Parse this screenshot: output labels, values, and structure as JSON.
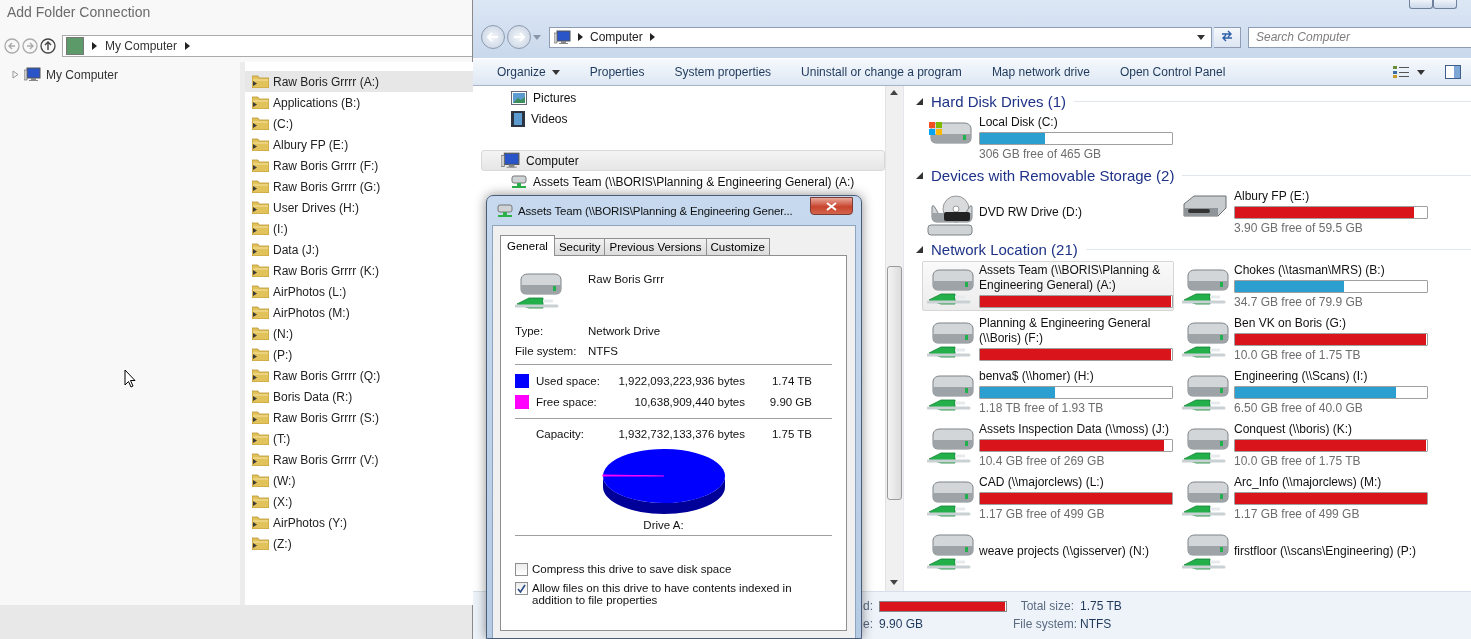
{
  "folder_dialog": {
    "title": "Add Folder Connection",
    "address": [
      "My Computer"
    ],
    "tree": [
      {
        "label": "My Computer",
        "expanded": false
      }
    ],
    "items": [
      {
        "label": "Raw Boris Grrrr (A:)",
        "selected": true
      },
      {
        "label": "Applications (B:)",
        "selected": false
      },
      {
        "label": "(C:)",
        "selected": false
      },
      {
        "label": "Albury FP (E:)",
        "selected": false
      },
      {
        "label": "Raw Boris Grrrr (F:)",
        "selected": false
      },
      {
        "label": "Raw Boris Grrrr (G:)",
        "selected": false
      },
      {
        "label": "User Drives (H:)",
        "selected": false
      },
      {
        "label": "(I:)",
        "selected": false
      },
      {
        "label": "Data (J:)",
        "selected": false
      },
      {
        "label": "Raw Boris Grrrr (K:)",
        "selected": false
      },
      {
        "label": "AirPhotos (L:)",
        "selected": false
      },
      {
        "label": "AirPhotos (M:)",
        "selected": false
      },
      {
        "label": "(N:)",
        "selected": false
      },
      {
        "label": "(P:)",
        "selected": false
      },
      {
        "label": "Raw Boris Grrrr (Q:)",
        "selected": false
      },
      {
        "label": "Boris Data (R:)",
        "selected": false
      },
      {
        "label": "Raw Boris Grrrr (S:)",
        "selected": false
      },
      {
        "label": "(T:)",
        "selected": false
      },
      {
        "label": "Raw Boris Grrrr (V:)",
        "selected": false
      },
      {
        "label": "(W:)",
        "selected": false
      },
      {
        "label": "(X:)",
        "selected": false
      },
      {
        "label": "AirPhotos (Y:)",
        "selected": false
      },
      {
        "label": "(Z:)",
        "selected": false
      }
    ]
  },
  "explorer": {
    "address": [
      "Computer"
    ],
    "search": {
      "placeholder": "Search Computer"
    },
    "toolbar": [
      {
        "label": "Organize",
        "kind": "menu"
      },
      {
        "label": "Properties",
        "kind": "button"
      },
      {
        "label": "System properties",
        "kind": "button"
      },
      {
        "label": "Uninstall or change a program",
        "kind": "button"
      },
      {
        "label": "Map network drive",
        "kind": "button"
      },
      {
        "label": "Open Control Panel",
        "kind": "button"
      }
    ],
    "nav": [
      {
        "label": "Pictures",
        "kind": "pictures",
        "selected": false
      },
      {
        "label": "Videos",
        "kind": "videos",
        "selected": false
      },
      {
        "label": "Computer",
        "kind": "computer",
        "selected": true,
        "children": [
          {
            "label": "Assets Team (\\\\BORIS\\Planning & Engineering General) (A:)",
            "kind": "network",
            "selected": false
          }
        ]
      }
    ],
    "groups": [
      {
        "title": "Hard Disk Drives (1)",
        "expanded": true,
        "drives": [
          {
            "name": "Local Disk (C:)",
            "kind": "windows",
            "level": 0.34,
            "color": "#2b9fd0",
            "free": "306 GB free of 465 GB",
            "selected": false
          }
        ]
      },
      {
        "title": "Devices with Removable Storage (2)",
        "expanded": true,
        "drives": [
          {
            "name": "DVD RW Drive (D:)",
            "kind": "dvd",
            "selected": false
          },
          {
            "name": "Albury FP (E:)",
            "kind": "removable",
            "level": 0.93,
            "color": "#d9141b",
            "free": "3.90 GB free of 59.5 GB",
            "selected": false
          }
        ]
      },
      {
        "title": "Network Location (21)",
        "expanded": true,
        "drives": [
          {
            "name": "Assets Team (\\\\BORIS\\Planning & Engineering General) (A:)",
            "kind": "network",
            "level": 0.995,
            "color": "#d9141b",
            "selected": true
          },
          {
            "name": "Chokes (\\\\tasman\\MRS) (B:)",
            "kind": "network",
            "level": 0.57,
            "color": "#2b9fd0",
            "free": "34.7 GB free of 79.9 GB",
            "selected": false
          },
          {
            "name": "Planning & Engineering General (\\\\Boris) (F:)",
            "kind": "network",
            "level": 0.995,
            "color": "#d9141b",
            "selected": false
          },
          {
            "name": "Ben VK on Boris (G:)",
            "kind": "network",
            "level": 0.995,
            "color": "#d9141b",
            "free": "10.0 GB free of 1.75 TB",
            "selected": false
          },
          {
            "name": "benva$ (\\\\homer) (H:)",
            "kind": "network",
            "level": 0.39,
            "color": "#2b9fd0",
            "free": "1.18 TB free of 1.93 TB",
            "selected": false
          },
          {
            "name": "Engineering (\\\\Scans) (I:)",
            "kind": "network",
            "level": 0.84,
            "color": "#2b9fd0",
            "free": "6.50 GB free of 40.0 GB",
            "selected": false
          },
          {
            "name": "Assets Inspection Data (\\\\moss) (J:)",
            "kind": "network",
            "level": 0.96,
            "color": "#d9141b",
            "free": "10.4 GB free of 269 GB",
            "selected": false
          },
          {
            "name": "Conquest (\\\\boris) (K:)",
            "kind": "network",
            "level": 0.995,
            "color": "#d9141b",
            "free": "10.0 GB free of 1.75 TB",
            "selected": false
          },
          {
            "name": "CAD (\\\\majorclews) (L:)",
            "kind": "network",
            "level": 0.998,
            "color": "#d9141b",
            "free": "1.17 GB free of 499 GB",
            "selected": false
          },
          {
            "name": "Arc_Info (\\\\majorclews) (M:)",
            "kind": "network",
            "level": 0.998,
            "color": "#d9141b",
            "free": "1.17 GB free of 499 GB",
            "selected": false
          },
          {
            "name": "weave projects (\\\\gisserver) (N:)",
            "kind": "network",
            "selected": false
          },
          {
            "name": "firstfloor (\\\\scans\\Engineering) (P:)",
            "kind": "network",
            "selected": false
          }
        ]
      }
    ],
    "details": [
      {
        "label": "d:",
        "kind": "bar",
        "level": 0.995,
        "color": "#d9141b"
      },
      {
        "label": "e:",
        "kind": "text",
        "value": "9.90 GB"
      },
      {
        "label": "Total size:",
        "kind": "text",
        "value": "1.75 TB"
      },
      {
        "label": "File system:",
        "kind": "text",
        "value": "NTFS"
      }
    ]
  },
  "properties_dialog": {
    "title": "Assets Team (\\\\BORIS\\Planning & Engineering Gener...",
    "tabs": [
      {
        "label": "General",
        "selected": true
      },
      {
        "label": "Security",
        "selected": false
      },
      {
        "label": "Previous Versions",
        "selected": false
      },
      {
        "label": "Customize",
        "selected": false
      }
    ],
    "name": "Raw Boris Grrr",
    "info": [
      {
        "label": "Type:",
        "value": "Network Drive"
      },
      {
        "label": "File system:",
        "value": "NTFS"
      }
    ],
    "space": [
      {
        "label": "Used space:",
        "bytes": "1,922,093,223,936 bytes",
        "size": "1.74 TB",
        "color": "#0000ff"
      },
      {
        "label": "Free space:",
        "bytes": "10,638,909,440 bytes",
        "size": "9.90 GB",
        "color": "#ff00ff"
      }
    ],
    "capacity": {
      "label": "Capacity:",
      "bytes": "1,932,732,133,376 bytes",
      "size": "1.75 TB"
    },
    "pie_caption": "Drive A:",
    "options": [
      {
        "label": "Compress this drive to save disk space",
        "checked": false
      },
      {
        "label": "Allow files on this drive to have contents indexed in addition to file properties",
        "checked": true
      }
    ]
  }
}
